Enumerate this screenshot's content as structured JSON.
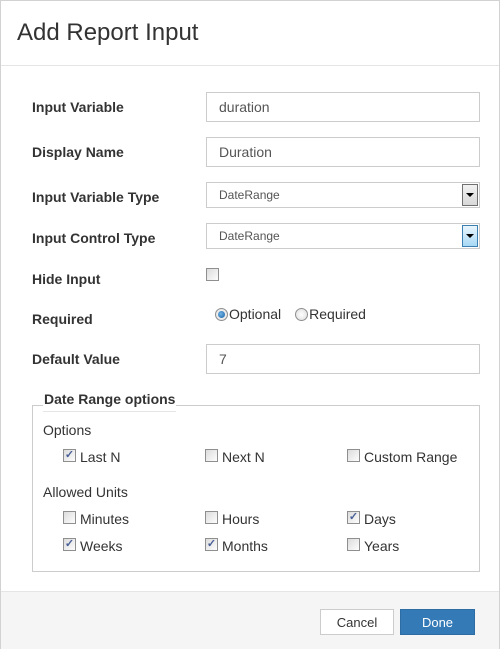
{
  "dialog": {
    "title": "Add Report Input"
  },
  "form": {
    "input_variable": {
      "label": "Input Variable",
      "value": "duration"
    },
    "display_name": {
      "label": "Display Name",
      "value": "Duration"
    },
    "input_variable_type": {
      "label": "Input Variable Type",
      "selected": "DateRange"
    },
    "input_control_type": {
      "label": "Input Control Type",
      "selected": "DateRange"
    },
    "hide_input": {
      "label": "Hide Input",
      "checked": false
    },
    "required": {
      "label": "Required",
      "options": [
        {
          "label": "Optional",
          "selected": true
        },
        {
          "label": "Required",
          "selected": false
        }
      ]
    },
    "default_value": {
      "label": "Default Value",
      "value": "7"
    }
  },
  "date_range_options": {
    "legend": "Date Range options",
    "options_label": "Options",
    "options": [
      {
        "label": "Last N",
        "checked": true
      },
      {
        "label": "Next N",
        "checked": false
      },
      {
        "label": "Custom Range",
        "checked": false
      }
    ],
    "allowed_units_label": "Allowed Units",
    "allowed_units": [
      {
        "label": "Minutes",
        "checked": false
      },
      {
        "label": "Hours",
        "checked": false
      },
      {
        "label": "Days",
        "checked": true
      },
      {
        "label": "Weeks",
        "checked": true
      },
      {
        "label": "Months",
        "checked": true
      },
      {
        "label": "Years",
        "checked": false
      }
    ]
  },
  "footer": {
    "cancel_label": "Cancel",
    "done_label": "Done"
  },
  "icons": {
    "check": "✓"
  },
  "colors": {
    "primary": "#337ab7"
  }
}
